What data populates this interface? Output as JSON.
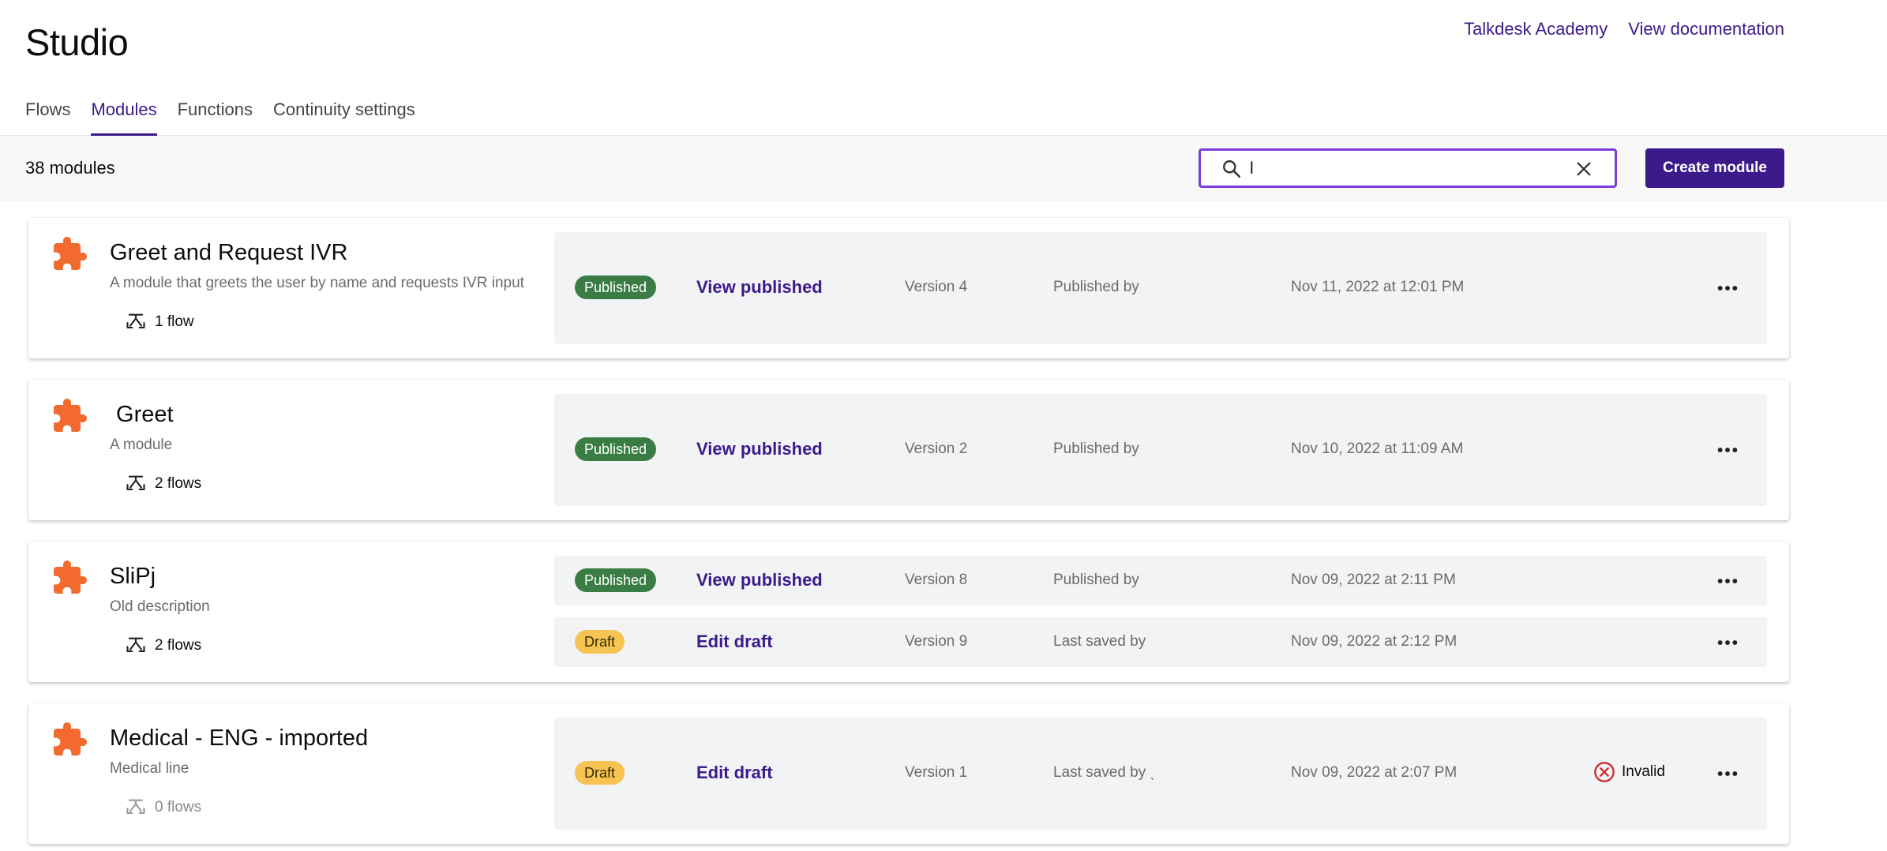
{
  "app": {
    "title": "Studio"
  },
  "top_links": [
    "Talkdesk Academy",
    "View documentation"
  ],
  "tabs": [
    {
      "label": "Flows",
      "active": false
    },
    {
      "label": "Modules",
      "active": true
    },
    {
      "label": "Functions",
      "active": false
    },
    {
      "label": "Continuity settings",
      "active": false
    }
  ],
  "toolbar": {
    "count": "38 modules",
    "search_value": "l",
    "create_label": "Create module"
  },
  "colors": {
    "accent": "#3c1a8a",
    "search_border": "#7a3ddb",
    "published": "#3a7d44",
    "draft": "#f7c453",
    "module_icon": "#f26a2e",
    "invalid": "#d02c2c"
  },
  "icons": {
    "search": "search-icon",
    "clear": "close-icon",
    "module": "puzzle-icon",
    "flows": "flow-icon",
    "invalid": "error-circle-icon",
    "more": "more-horizontal-icon"
  },
  "modules": [
    {
      "name": "Greet and Request IVR",
      "description": "A module that greets the user by name and requests IVR input",
      "flows": "1 flow",
      "versions": [
        {
          "status": "Published",
          "link": "View published",
          "version": "Version 4",
          "by": "Published by",
          "date": "Nov 11, 2022 at 12:01 PM"
        }
      ]
    },
    {
      "name": " Greet",
      "description": "A module",
      "flows": "2 flows",
      "versions": [
        {
          "status": "Published",
          "link": "View published",
          "version": "Version 2",
          "by": "Published by",
          "date": "Nov 10, 2022 at 11:09 AM"
        }
      ]
    },
    {
      "name": "SliPj",
      "description": "Old description",
      "flows": "2 flows",
      "versions": [
        {
          "status": "Published",
          "link": "View published",
          "version": "Version 8",
          "by": "Published by",
          "date": "Nov 09, 2022 at 2:11 PM"
        },
        {
          "status": "Draft",
          "link": "Edit draft",
          "version": "Version 9",
          "by": "Last saved by",
          "date": "Nov 09, 2022 at 2:12 PM"
        }
      ]
    },
    {
      "name": "Medical - ENG - imported",
      "description": "Medical line",
      "flows": "0 flows",
      "versions": [
        {
          "status": "Draft",
          "link": "Edit draft",
          "version": "Version 1",
          "by": "Last saved by ˎ",
          "date": "Nov 09, 2022 at 2:07 PM",
          "validation": "Invalid"
        }
      ]
    }
  ]
}
